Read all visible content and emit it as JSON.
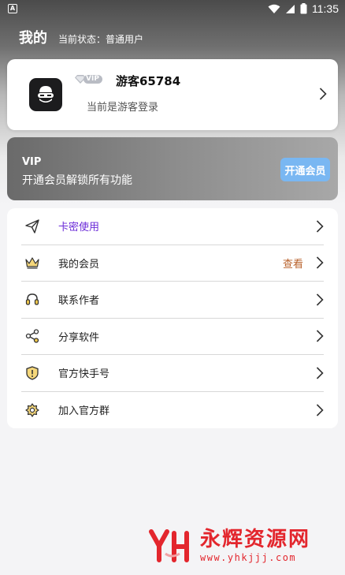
{
  "status_bar": {
    "time": "11:35"
  },
  "header": {
    "title": "我的",
    "status": "当前状态：普通用户"
  },
  "profile": {
    "vip_badge": "VIP",
    "username": "游客65784",
    "login_status": "当前是游客登录"
  },
  "vip_banner": {
    "title": "VIP",
    "subtitle": "开通会员解锁所有功能",
    "button": "开通会员"
  },
  "menu": {
    "items": [
      {
        "label": "卡密使用",
        "icon": "paper-plane-icon",
        "extra": ""
      },
      {
        "label": "我的会员",
        "icon": "crown-icon",
        "extra": "查看"
      },
      {
        "label": "联系作者",
        "icon": "headset-icon",
        "extra": ""
      },
      {
        "label": "分享软件",
        "icon": "share-icon",
        "extra": ""
      },
      {
        "label": "官方快手号",
        "icon": "shield-icon",
        "extra": ""
      },
      {
        "label": "加入官方群",
        "icon": "badge-icon",
        "extra": ""
      }
    ]
  },
  "watermark": {
    "title": "永辉资源网",
    "url": "www.yhkjjj.com"
  },
  "colors": {
    "accent": "#6b2bd8",
    "vip_button": "#79b7f2",
    "extra": "#b8602a",
    "watermark": "#e3262d"
  }
}
